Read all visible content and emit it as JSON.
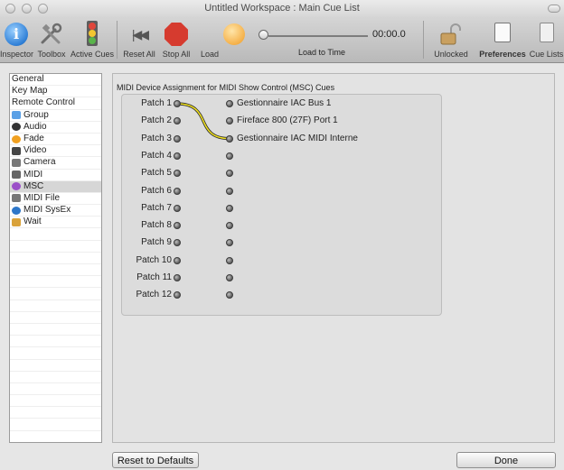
{
  "window": {
    "title": "Untitled Workspace : Main Cue List"
  },
  "toolbar": {
    "inspector": "Inspector",
    "toolbox": "Toolbox",
    "active_cues": "Active Cues",
    "reset_all": "Reset All",
    "stop_all": "Stop All",
    "load": "Load",
    "load_to_time": "Load to Time",
    "time": "00:00.0",
    "unlocked": "Unlocked",
    "preferences": "Preferences",
    "cue_lists": "Cue Lists"
  },
  "sidebar": {
    "items": [
      {
        "label": "General",
        "icon": "none"
      },
      {
        "label": "Key Map",
        "icon": "none"
      },
      {
        "label": "Remote Control",
        "icon": "none"
      },
      {
        "label": "Group",
        "icon": "folder-icon"
      },
      {
        "label": "Audio",
        "icon": "speaker-icon"
      },
      {
        "label": "Fade",
        "icon": "fade-icon"
      },
      {
        "label": "Video",
        "icon": "video-icon"
      },
      {
        "label": "Camera",
        "icon": "camera-icon"
      },
      {
        "label": "MIDI",
        "icon": "midi-keyboard-icon"
      },
      {
        "label": "MSC",
        "icon": "msc-icon"
      },
      {
        "label": "MIDI File",
        "icon": "midi-file-icon"
      },
      {
        "label": "MIDI SysEx",
        "icon": "globe-icon"
      },
      {
        "label": "Wait",
        "icon": "hourglass-icon"
      }
    ],
    "selected": "MSC"
  },
  "msc": {
    "group_title": "MIDI Device Assignment for MIDI Show Control (MSC) Cues",
    "patches": [
      "Patch 1",
      "Patch 2",
      "Patch 3",
      "Patch 4",
      "Patch 5",
      "Patch 6",
      "Patch 7",
      "Patch 8",
      "Patch 9",
      "Patch 10",
      "Patch 11",
      "Patch 12"
    ],
    "destinations": [
      "Gestionnaire IAC Bus 1",
      "Fireface 800 (27F) Port 1",
      "Gestionnaire IAC MIDI Interne",
      "",
      "",
      "",
      "",
      "",
      "",
      "",
      "",
      ""
    ],
    "connections": [
      {
        "from": "Patch 1",
        "to": "Gestionnaire IAC MIDI Interne"
      }
    ],
    "cable_color": "#f0e020"
  },
  "buttons": {
    "reset": "Reset to Defaults",
    "done": "Done"
  }
}
